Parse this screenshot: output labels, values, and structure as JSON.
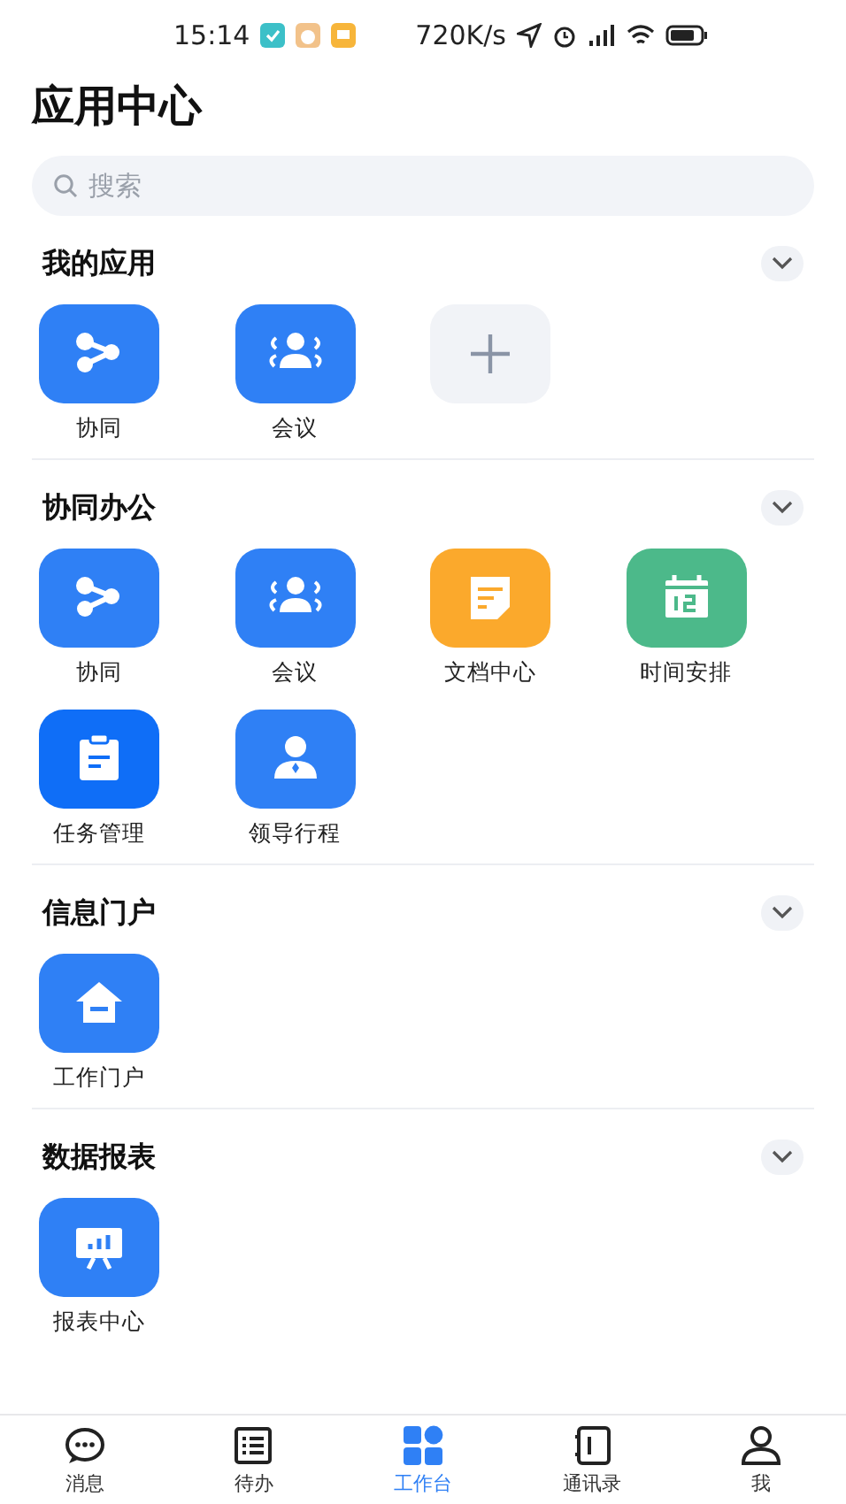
{
  "status_bar": {
    "time": "15:14",
    "speed": "720K/s"
  },
  "title": "应用中心",
  "search": {
    "placeholder": "搜索"
  },
  "sections": [
    {
      "title": "我的应用",
      "expanded": true,
      "apps": [
        {
          "label": "协同",
          "kind": "share",
          "color": "#2f80f5"
        },
        {
          "label": "会议",
          "kind": "meeting",
          "color": "#2f80f5"
        },
        {
          "kind": "add",
          "color": "#f1f3f7"
        }
      ]
    },
    {
      "title": "协同办公",
      "expanded": true,
      "apps": [
        {
          "label": "协同",
          "kind": "share",
          "color": "#2f80f5"
        },
        {
          "label": "会议",
          "kind": "meeting",
          "color": "#2f80f5"
        },
        {
          "label": "文档中心",
          "kind": "document",
          "color": "#fba92c"
        },
        {
          "label": "时间安排",
          "kind": "calendar",
          "color": "#4cb98a"
        },
        {
          "label": "任务管理",
          "kind": "clipboard",
          "color": "#0f6ef7"
        },
        {
          "label": "领导行程",
          "kind": "person",
          "color": "#2f80f5"
        }
      ]
    },
    {
      "title": "信息门户",
      "expanded": true,
      "apps": [
        {
          "label": "工作门户",
          "kind": "home",
          "color": "#2f80f5"
        }
      ]
    },
    {
      "title": "数据报表",
      "expanded": true,
      "apps": [
        {
          "label": "报表中心",
          "kind": "report",
          "color": "#2f80f5"
        }
      ]
    }
  ],
  "tabs": [
    {
      "label": "消息",
      "kind": "chat",
      "selected": false
    },
    {
      "label": "待办",
      "kind": "list",
      "selected": false
    },
    {
      "label": "工作台",
      "kind": "grid",
      "selected": true
    },
    {
      "label": "通讯录",
      "kind": "book",
      "selected": false
    },
    {
      "label": "我",
      "kind": "person",
      "selected": false
    }
  ]
}
